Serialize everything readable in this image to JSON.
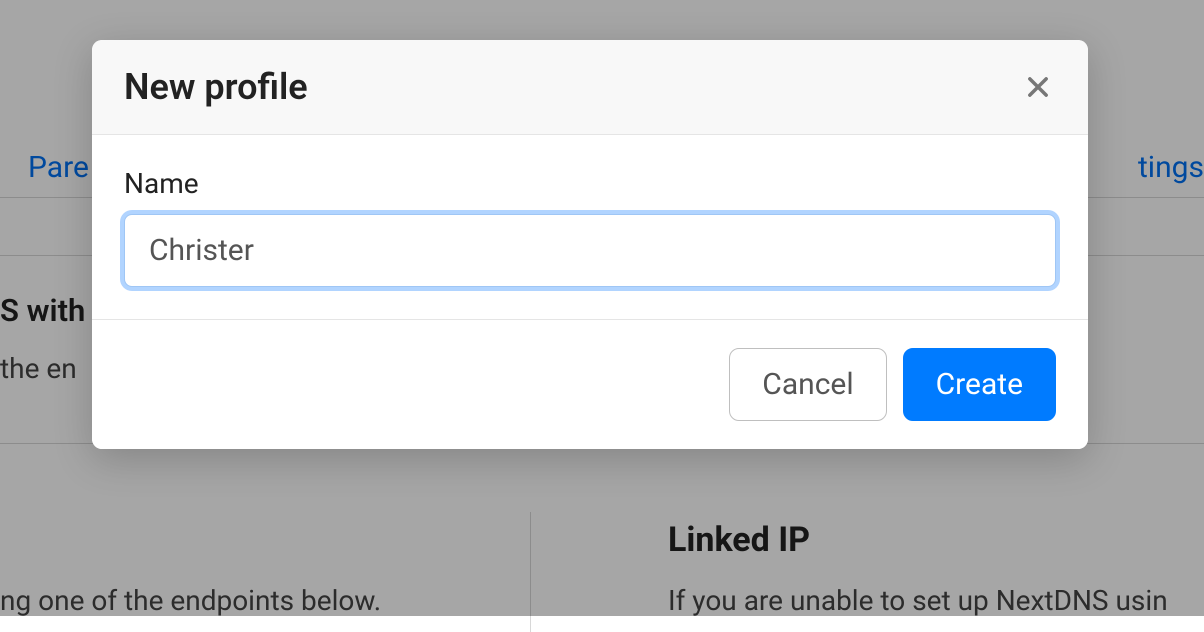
{
  "background": {
    "tab_left": "Pare",
    "tab_right": "tings",
    "text_1": "S with a",
    "text_2": "the en",
    "text_3": "ng one of the endpoints below.",
    "heading_right": "Linked IP",
    "text_4": "If you are unable to set up NextDNS usin"
  },
  "modal": {
    "title": "New profile",
    "name_label": "Name",
    "name_value": "Christer",
    "cancel_label": "Cancel",
    "create_label": "Create"
  }
}
